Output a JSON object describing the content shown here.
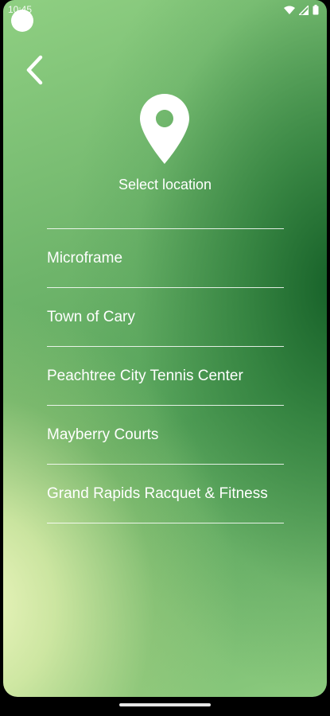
{
  "status_bar": {
    "time": "10:45",
    "icons": [
      "wifi-icon",
      "signal-icon",
      "battery-icon"
    ]
  },
  "header": {
    "back_icon": "chevron-left-icon",
    "location_icon": "map-pin-icon",
    "title": "Select location"
  },
  "locations": [
    {
      "label": "Microframe"
    },
    {
      "label": "Town of Cary"
    },
    {
      "label": "Peachtree City Tennis Center"
    },
    {
      "label": "Mayberry Courts"
    },
    {
      "label": "Grand Rapids Racquet & Fitness"
    }
  ],
  "colors": {
    "gradient_light": "#EEF6C0",
    "gradient_mid": "#6FB56B",
    "gradient_dark": "#166028",
    "text": "#FFFFFF"
  }
}
